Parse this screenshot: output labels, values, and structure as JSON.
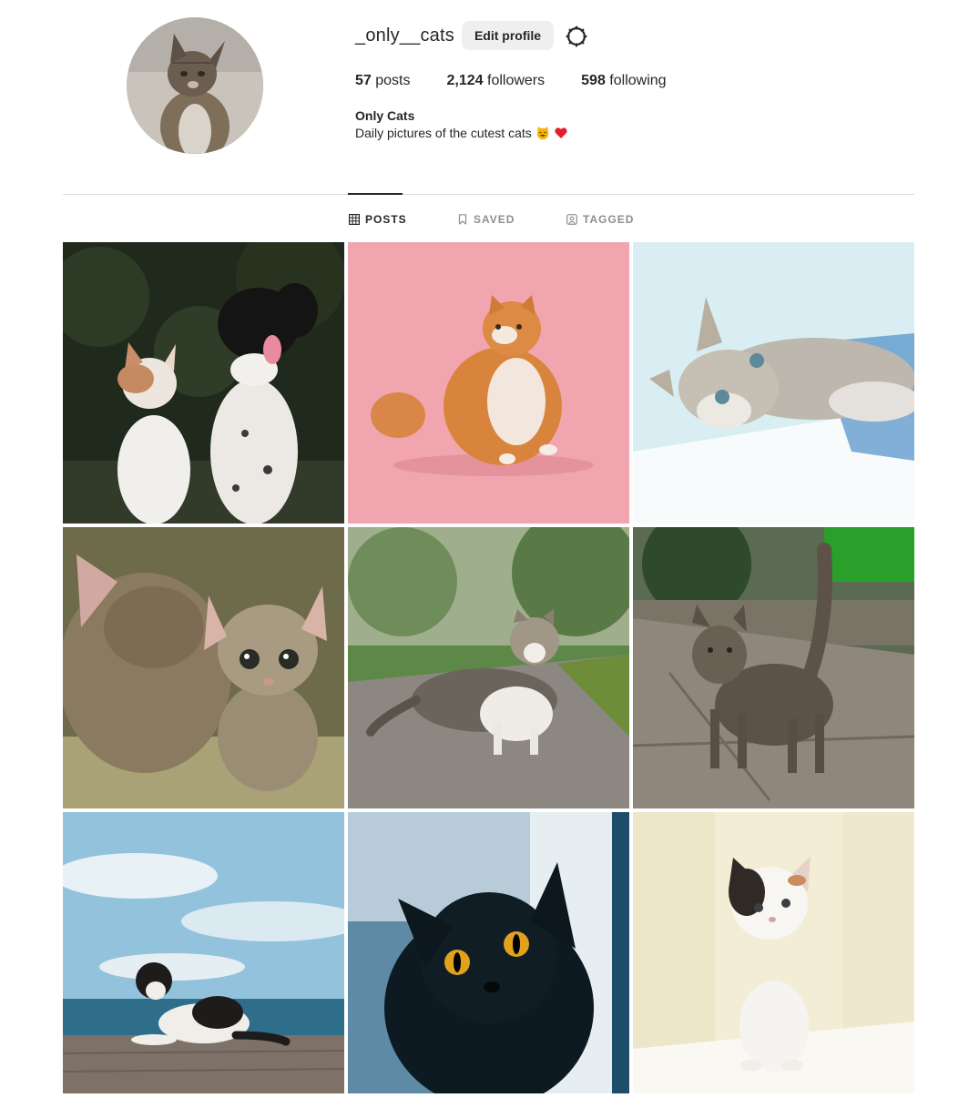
{
  "profile": {
    "username": "_only__cats",
    "edit_label": "Edit profile",
    "settings_icon": "gear-icon",
    "posts_count": "57",
    "posts_label": "posts",
    "followers_count": "2,124",
    "followers_label": "followers",
    "following_count": "598",
    "following_label": "following",
    "full_name": "Only Cats",
    "bio": "Daily pictures of the cutest cats"
  },
  "tabs": [
    {
      "label": "POSTS",
      "icon": "grid-icon",
      "active": true
    },
    {
      "label": "SAVED",
      "icon": "bookmark-icon",
      "active": false
    },
    {
      "label": "TAGGED",
      "icon": "tag-user-icon",
      "active": false
    }
  ],
  "posts": [
    {
      "icon": "kitten-and-puppy"
    },
    {
      "icon": "orange-cat-pink-background"
    },
    {
      "icon": "tabby-lying-on-table"
    },
    {
      "icon": "two-tabby-kittens"
    },
    {
      "icon": "tabby-white-cat-walking"
    },
    {
      "icon": "tabby-cat-standing"
    },
    {
      "icon": "black-white-cat-by-sea"
    },
    {
      "icon": "black-cat-yellow-eyes"
    },
    {
      "icon": "white-calico-kitten"
    }
  ],
  "colors": {
    "text": "#262626",
    "muted": "#8e8e8e",
    "divider": "#dbdbdb",
    "button_bg": "#efefef"
  }
}
